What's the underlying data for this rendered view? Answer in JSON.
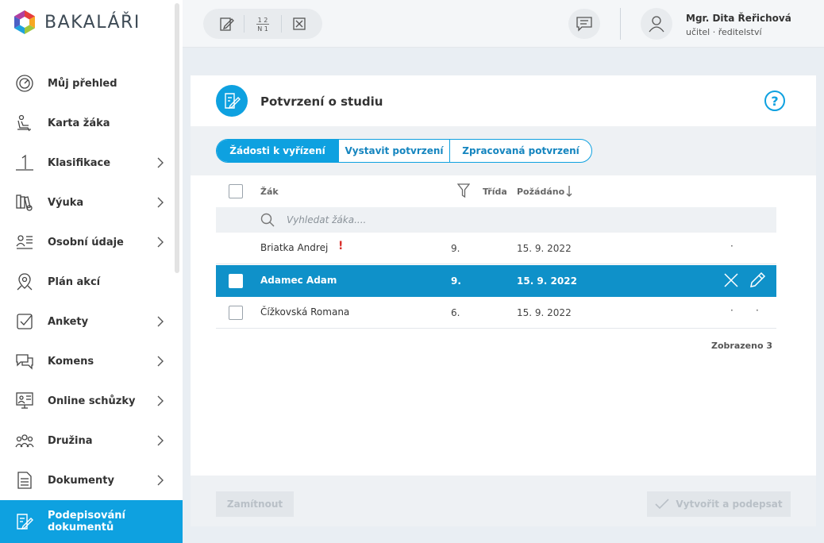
{
  "app": {
    "logo_text": "BAKALÁŘI"
  },
  "sidebar": {
    "items": [
      {
        "label": "Můj přehled",
        "icon": "dashboard-gauge-icon",
        "has_submenu": false
      },
      {
        "label": "Karta žáka",
        "icon": "student-seat-icon",
        "has_submenu": false
      },
      {
        "label": "Klasifikace",
        "icon": "grade-one-icon",
        "has_submenu": true
      },
      {
        "label": "Výuka",
        "icon": "books-icon",
        "has_submenu": true
      },
      {
        "label": "Osobní údaje",
        "icon": "person-card-icon",
        "has_submenu": true
      },
      {
        "label": "Plán akcí",
        "icon": "map-pin-icon",
        "has_submenu": false
      },
      {
        "label": "Ankety",
        "icon": "checkbox-icon",
        "has_submenu": true
      },
      {
        "label": "Komens",
        "icon": "chat-bubbles-icon",
        "has_submenu": true
      },
      {
        "label": "Online schůzky",
        "icon": "online-meeting-icon",
        "has_submenu": true
      },
      {
        "label": "Družina",
        "icon": "group-icon",
        "has_submenu": true
      },
      {
        "label": "Dokumenty",
        "icon": "document-icon",
        "has_submenu": true
      },
      {
        "label": "Podepisování dokumentů",
        "icon": "sign-document-icon",
        "has_submenu": false,
        "active": true
      }
    ]
  },
  "topbar": {
    "tools": [
      "edit-icon",
      "grade-matrix-icon",
      "cancel-box-icon"
    ],
    "tool_matrix_text": {
      "top": "1 2",
      "bottom": "N 1"
    },
    "user_name": "Mgr. Dita Řeřichová",
    "user_role": "učitel · ředitelství"
  },
  "main": {
    "title": "Potvrzení o studiu",
    "help": "?",
    "tabs": [
      {
        "label": "Žádosti k vyřízení",
        "active": true
      },
      {
        "label": "Vystavit potvrzení",
        "active": false
      },
      {
        "label": "Zpracovaná potvrzení",
        "active": false
      }
    ],
    "columns": {
      "student": "Žák",
      "class": "Třída",
      "requested": "Požádáno"
    },
    "search_placeholder": "Vyhledat žáka....",
    "rows": [
      {
        "name": "Briatka Andrej",
        "class": "9.",
        "date": "15. 9. 2022",
        "flag": "!",
        "selected": false
      },
      {
        "name": "Adamec Adam",
        "class": "9.",
        "date": "15. 9. 2022",
        "selected": true
      },
      {
        "name": "Čížkovská Romana",
        "class": "6.",
        "date": "15. 9. 2022",
        "selected": false
      }
    ],
    "shown_count": "Zobrazeno 3",
    "buttons": {
      "reject": "Zamítnout",
      "create_sign": "Vytvořit a podepsat"
    }
  },
  "colors": {
    "accent": "#0ea1e0",
    "selected_row": "#0f91c9",
    "flag": "#d9302c"
  }
}
